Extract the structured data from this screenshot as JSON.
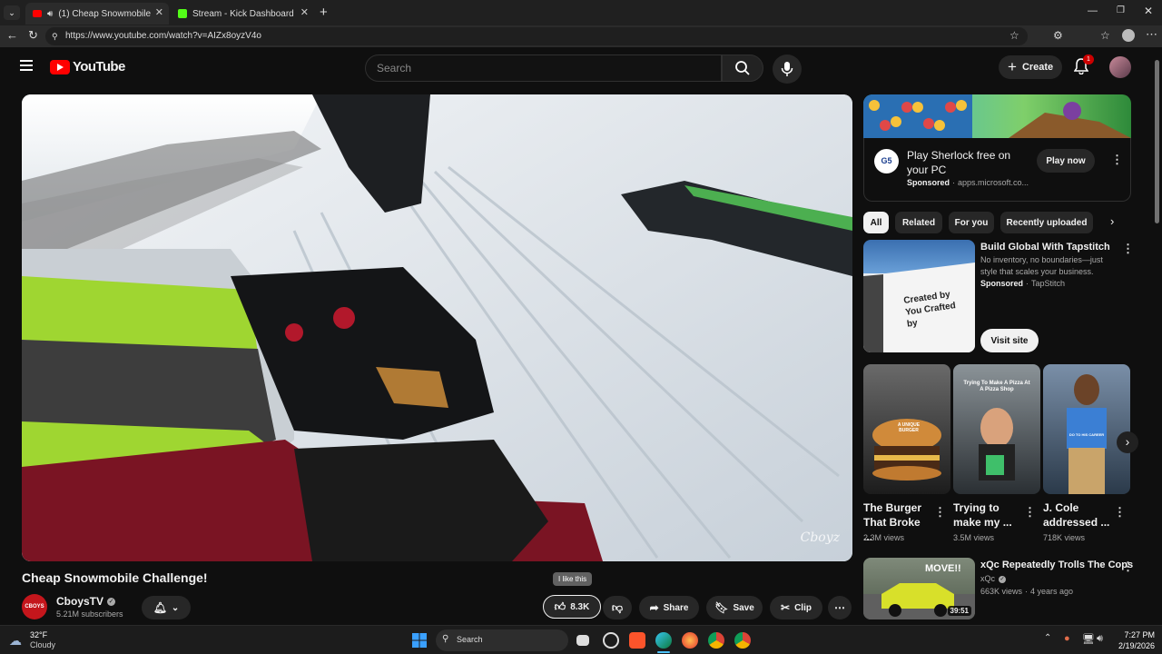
{
  "browser": {
    "tabs": [
      {
        "label": "(1) Cheap Snowmobile Challe",
        "active": true
      },
      {
        "label": "Stream - Kick Dashboard",
        "active": false
      }
    ],
    "url": "https://www.youtube.com/watch?v=AIZx8oyzV4o"
  },
  "header": {
    "logo_text": "YouTube",
    "search_placeholder": "Search",
    "create_label": "Create",
    "notification_count": "1"
  },
  "video": {
    "watermark": "Cboyz",
    "title": "Cheap Snowmobile Challenge!",
    "channel_name": "CboysTV",
    "channel_avatar_text": "CBOYS",
    "subscribers": "5.21M subscribers",
    "tooltip": "I like this",
    "like_count": "8.3K",
    "share_label": "Share",
    "save_label": "Save",
    "clip_label": "Clip"
  },
  "ad": {
    "title": "Play Sherlock free on your PC",
    "sponsored": "Sponsored",
    "domain": "apps.microsoft.co...",
    "cta": "Play now",
    "logo_text": "G5"
  },
  "chips": [
    "All",
    "Related",
    "For you",
    "Recently uploaded"
  ],
  "sponsored_card": {
    "title": "Build Global With Tapstitch",
    "description": "No inventory, no boundaries—just style that scales your business.",
    "sponsored": "Sponsored",
    "advertiser": "TapStitch",
    "cta": "Visit site",
    "thumb_text": "Created by You Crafted by"
  },
  "shorts": [
    {
      "title": "The Burger That Broke ...",
      "views": "2.3M views",
      "caption": "A UNIQUE BURGER"
    },
    {
      "title": "Trying to make my ...",
      "views": "3.5M views",
      "caption": "Trying To Make A Pizza At A Pizza Shop"
    },
    {
      "title": "J. Cole addressed ...",
      "views": "718K views",
      "caption": "DO TO HIS CAREER"
    }
  ],
  "recommended": [
    {
      "title": "xQc Repeatedly Trolls The Cops",
      "channel": "xQc",
      "views": "663K views",
      "age": "4 years ago",
      "duration": "39:51",
      "thumb_text": "MOVE!!"
    }
  ],
  "taskbar": {
    "weather_temp": "32°F",
    "weather_desc": "Cloudy",
    "search_label": "Search",
    "time": "7:27 PM",
    "date": "2/19/2026"
  },
  "colors": {
    "brand_red": "#ff0000",
    "bg": "#0f0f0f",
    "chip_bg": "#272727"
  }
}
